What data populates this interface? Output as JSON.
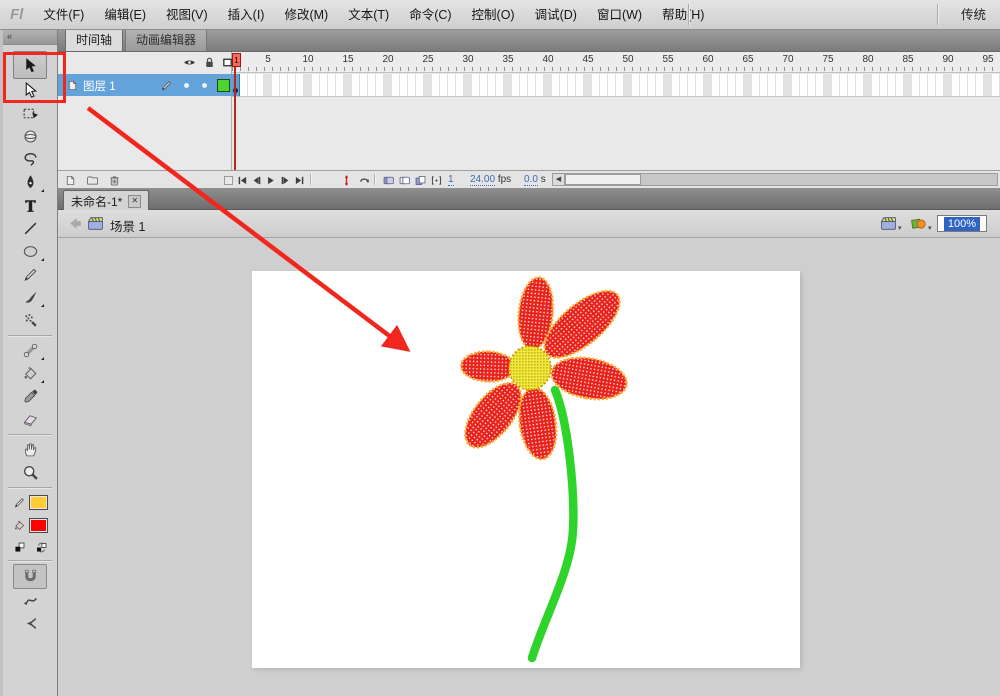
{
  "app": {
    "logo": "Fl",
    "workspace_switcher": "传统"
  },
  "menu": {
    "items": [
      "文件(F)",
      "编辑(E)",
      "视图(V)",
      "插入(I)",
      "修改(M)",
      "文本(T)",
      "命令(C)",
      "控制(O)",
      "调试(D)",
      "窗口(W)",
      "帮助(H)"
    ]
  },
  "timeline": {
    "tabs": [
      {
        "label": "时间轴",
        "active": true
      },
      {
        "label": "动画编辑器",
        "active": false
      }
    ],
    "layer": {
      "name": "图层 1",
      "outline_color": "#4ED32F",
      "selected": true
    },
    "ruler_numbers": [
      5,
      10,
      15,
      20,
      25,
      30,
      35,
      40,
      45,
      50,
      55,
      60,
      65,
      70,
      75,
      80,
      85,
      90,
      95
    ],
    "current_frame": "1",
    "status": {
      "frame": "1",
      "fps_value": "24.00",
      "fps_unit": "fps",
      "elapsed_value": "0.0",
      "elapsed_unit": "s"
    }
  },
  "document": {
    "tab_label": "未命名-1*",
    "scene_label": "场景 1",
    "zoom_value": "100%"
  },
  "toolbar": {
    "collapse_glyph": "«",
    "tools": [
      {
        "name": "selection-tool",
        "icon": "arrow-black",
        "active": true
      },
      {
        "name": "subselection-tool",
        "icon": "arrow-white"
      },
      {
        "name": "free-transform-tool",
        "icon": "free-transform"
      },
      {
        "name": "3d-rotation-tool",
        "icon": "sphere-3d"
      },
      {
        "name": "lasso-tool",
        "icon": "lasso"
      },
      {
        "name": "pen-tool",
        "icon": "pen",
        "flyout": true
      },
      {
        "name": "text-tool",
        "icon": "text"
      },
      {
        "name": "line-tool",
        "icon": "line"
      },
      {
        "name": "oval-tool",
        "icon": "oval",
        "flyout": true
      },
      {
        "name": "pencil-tool",
        "icon": "pencil"
      },
      {
        "name": "brush-tool",
        "icon": "brush",
        "flyout": true
      },
      {
        "name": "spray-brush-tool",
        "icon": "spray"
      },
      {
        "type": "divider"
      },
      {
        "name": "bone-tool",
        "icon": "bone",
        "flyout": true
      },
      {
        "name": "paint-bucket-tool",
        "icon": "bucket",
        "flyout": true
      },
      {
        "name": "eyedropper-tool",
        "icon": "eyedropper"
      },
      {
        "name": "eraser-tool",
        "icon": "eraser"
      },
      {
        "type": "divider"
      },
      {
        "name": "hand-tool",
        "icon": "hand"
      },
      {
        "name": "zoom-tool",
        "icon": "magnifier"
      },
      {
        "type": "divider"
      },
      {
        "type": "swatch",
        "name": "stroke-color-control",
        "icon": "pencil",
        "color": "#FFCC33"
      },
      {
        "type": "swatch",
        "name": "fill-color-control",
        "icon": "bucket",
        "color": "#FF0000"
      },
      {
        "type": "pair"
      },
      {
        "type": "divider"
      },
      {
        "name": "snap-to-objects-toggle",
        "icon": "magnet",
        "pressed": true
      },
      {
        "name": "smooth-option",
        "icon": "smooth"
      },
      {
        "name": "straighten-option",
        "icon": "straighten"
      }
    ],
    "stroke_color": "#FFCC33",
    "fill_color": "#FF0000"
  },
  "artwork": {
    "petal_color": "#E8231C",
    "petal_outline_color": "#FFAE2E",
    "center_color": "#F2E93C",
    "center_dot_color": "#8A7A00",
    "stem_color": "#2ED42A"
  },
  "annotation": {
    "color": "#F1261D"
  }
}
